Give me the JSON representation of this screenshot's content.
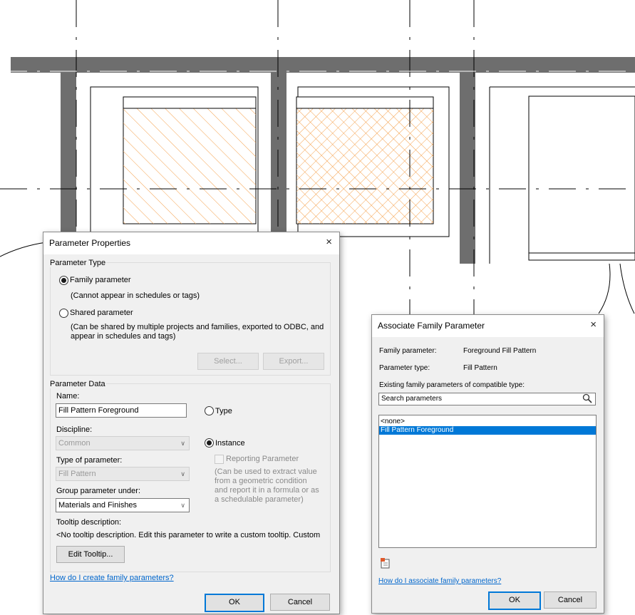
{
  "parameter_properties": {
    "title": "Parameter Properties",
    "close_glyph": "×",
    "parameter_type": {
      "legend": "Parameter Type",
      "family_label": "Family parameter",
      "family_note": "(Cannot appear in schedules or tags)",
      "shared_label": "Shared parameter",
      "shared_note_1": "(Can be shared by multiple projects and families, exported to ODBC, and",
      "shared_note_2": "appear in schedules and tags)",
      "select_button": "Select...",
      "export_button": "Export...",
      "selected": "Family parameter"
    },
    "parameter_data": {
      "legend": "Parameter Data",
      "name_label": "Name:",
      "name_value": "Fill Pattern Foreground",
      "type_label": "Type",
      "instance_label": "Instance",
      "selected_scope": "Instance",
      "discipline_label": "Discipline:",
      "discipline_value": "Common",
      "reporting_label": "Reporting Parameter",
      "reporting_note": [
        "(Can be used to extract value",
        "from a geometric condition",
        "and report it in a formula or as",
        "a schedulable parameter)"
      ],
      "type_of_parameter_label": "Type of parameter:",
      "type_of_parameter_value": "Fill Pattern",
      "group_label": "Group parameter under:",
      "group_value": "Materials and Finishes",
      "tooltip_label": "Tooltip description:",
      "tooltip_value": "<No tooltip description. Edit this parameter to write a custom tooltip. Custom",
      "edit_tooltip_button": "Edit Tooltip..."
    },
    "help_link": "How do I create family parameters?",
    "ok_button": "OK",
    "cancel_button": "Cancel"
  },
  "associate_family_parameter": {
    "title": "Associate Family Parameter",
    "close_glyph": "×",
    "family_parameter_label": "Family parameter:",
    "family_parameter_value": "Foreground Fill Pattern",
    "parameter_type_label": "Parameter type:",
    "parameter_type_value": "Fill Pattern",
    "existing_label": "Existing family parameters of compatible type:",
    "search_placeholder": "Search parameters",
    "list_items": [
      "<none>",
      "Fill Pattern Foreground"
    ],
    "selected_item": "Fill Pattern Foreground",
    "help_link": "How do I associate family parameters?",
    "ok_button": "OK",
    "cancel_button": "Cancel"
  },
  "colors": {
    "wall": "#6e6e6e",
    "hatch": "#f5a04a",
    "selection": "#0078d7",
    "link": "#0066cc"
  }
}
